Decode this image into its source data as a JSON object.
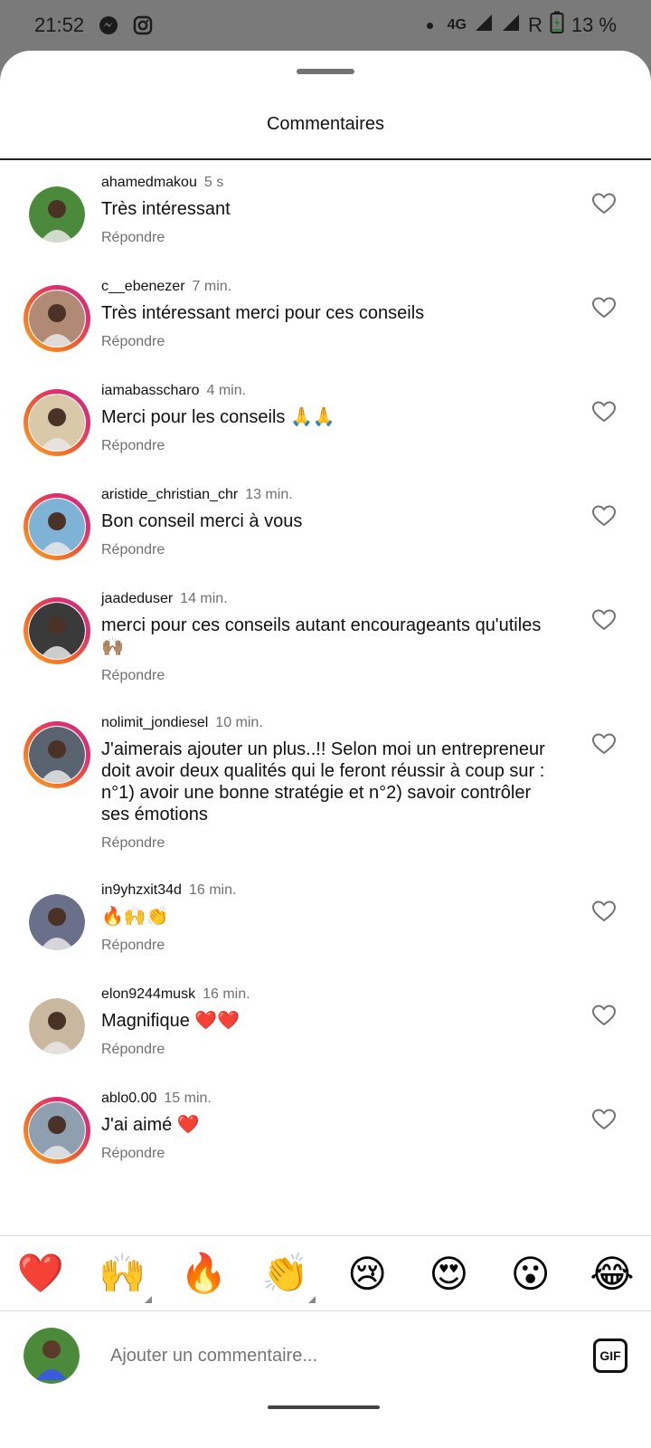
{
  "status_bar": {
    "time": "21:52",
    "network": "4G",
    "roaming": "R",
    "battery": "13 %"
  },
  "sheet": {
    "title": "Commentaires"
  },
  "comments": [
    {
      "user": "ahamedmakou",
      "time": "5 s",
      "text": "Très intéressant",
      "reply": "Répondre",
      "story": false,
      "avatar_color": "#4a8a3a"
    },
    {
      "user": "c__ebenezer",
      "time": "7 min.",
      "text": "Très intéressant merci pour ces conseils",
      "reply": "Répondre",
      "story": true,
      "avatar_color": "#b08a74"
    },
    {
      "user": "iamabasscharo",
      "time": "4 min.",
      "text": "Merci pour les conseils 🙏🙏",
      "reply": "Répondre",
      "story": true,
      "avatar_color": "#d9c9a8"
    },
    {
      "user": "aristide_christian_chr",
      "time": "13 min.",
      "text": "Bon conseil merci à vous",
      "reply": "Répondre",
      "story": true,
      "avatar_color": "#7fb3d5"
    },
    {
      "user": "jaadeduser",
      "time": "14 min.",
      "text": "merci pour ces conseils autant encourageants qu'utiles 🙌🏽",
      "reply": "Répondre",
      "story": true,
      "avatar_color": "#3a3a3a"
    },
    {
      "user": "nolimit_jondiesel",
      "time": "10 min.",
      "text": "J'aimerais ajouter un plus..!! Selon moi un entrepreneur doit avoir deux qualités qui le feront réussir à coup sur : n°1) avoir une bonne stratégie et n°2) savoir contrôler ses émotions",
      "reply": "Répondre",
      "story": true,
      "avatar_color": "#5a6470"
    },
    {
      "user": "in9yhzxit34d",
      "time": "16 min.",
      "text": "🔥🙌👏",
      "reply": "Répondre",
      "story": false,
      "avatar_color": "#6a6f8a"
    },
    {
      "user": "elon9244musk",
      "time": "16 min.",
      "text": "Magnifique ❤️❤️",
      "reply": "Répondre",
      "story": false,
      "avatar_color": "#c9b7a0"
    },
    {
      "user": "ablo0.00",
      "time": "15 min.",
      "text": "J'ai aimé ❤️",
      "reply": "Répondre",
      "story": true,
      "avatar_color": "#8ea0b0"
    }
  ],
  "reactions": [
    {
      "emoji": "❤️",
      "variants": false
    },
    {
      "emoji": "🙌",
      "variants": true
    },
    {
      "emoji": "🔥",
      "variants": false
    },
    {
      "emoji": "👏",
      "variants": true
    },
    {
      "emoji": "😢",
      "variants": false
    },
    {
      "emoji": "😍",
      "variants": false
    },
    {
      "emoji": "😮",
      "variants": false
    },
    {
      "emoji": "😂",
      "variants": false
    }
  ],
  "composer": {
    "placeholder": "Ajouter un commentaire...",
    "gif_label": "GIF"
  }
}
